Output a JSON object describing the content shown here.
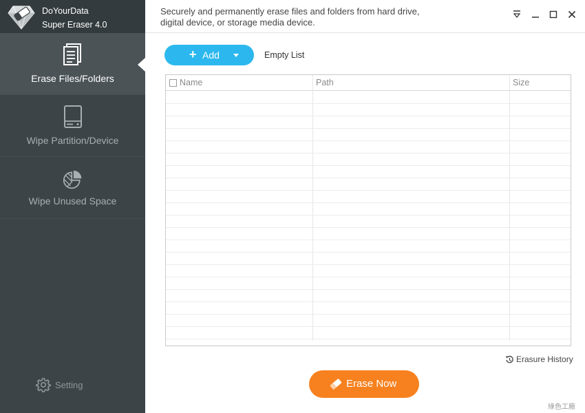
{
  "app": {
    "name_line1": "DoYourData",
    "name_line2": "Super Eraser 4.0",
    "description_line1": "Securely and permanently erase files and folders from hard drive,",
    "description_line2": "digital device, or storage media device."
  },
  "sidebar": {
    "items": [
      {
        "label": "Erase Files/Folders",
        "icon": "document-icon",
        "active": true
      },
      {
        "label": "Wipe Partition/Device",
        "icon": "drive-icon",
        "active": false
      },
      {
        "label": "Wipe Unused Space",
        "icon": "pie-chart-icon",
        "active": false
      }
    ],
    "setting_label": "Setting"
  },
  "toolbar": {
    "add_label": "Add",
    "empty_list_label": "Empty List"
  },
  "table": {
    "columns": [
      "Name",
      "Path",
      "Size"
    ],
    "rows": []
  },
  "footer": {
    "erasure_history_label": "Erasure History",
    "erase_now_label": "Erase Now",
    "watermark": "綠色工廠"
  },
  "colors": {
    "sidebar_bg": "#3d4447",
    "accent_blue": "#2cb8ee",
    "accent_orange": "#f7811f"
  }
}
